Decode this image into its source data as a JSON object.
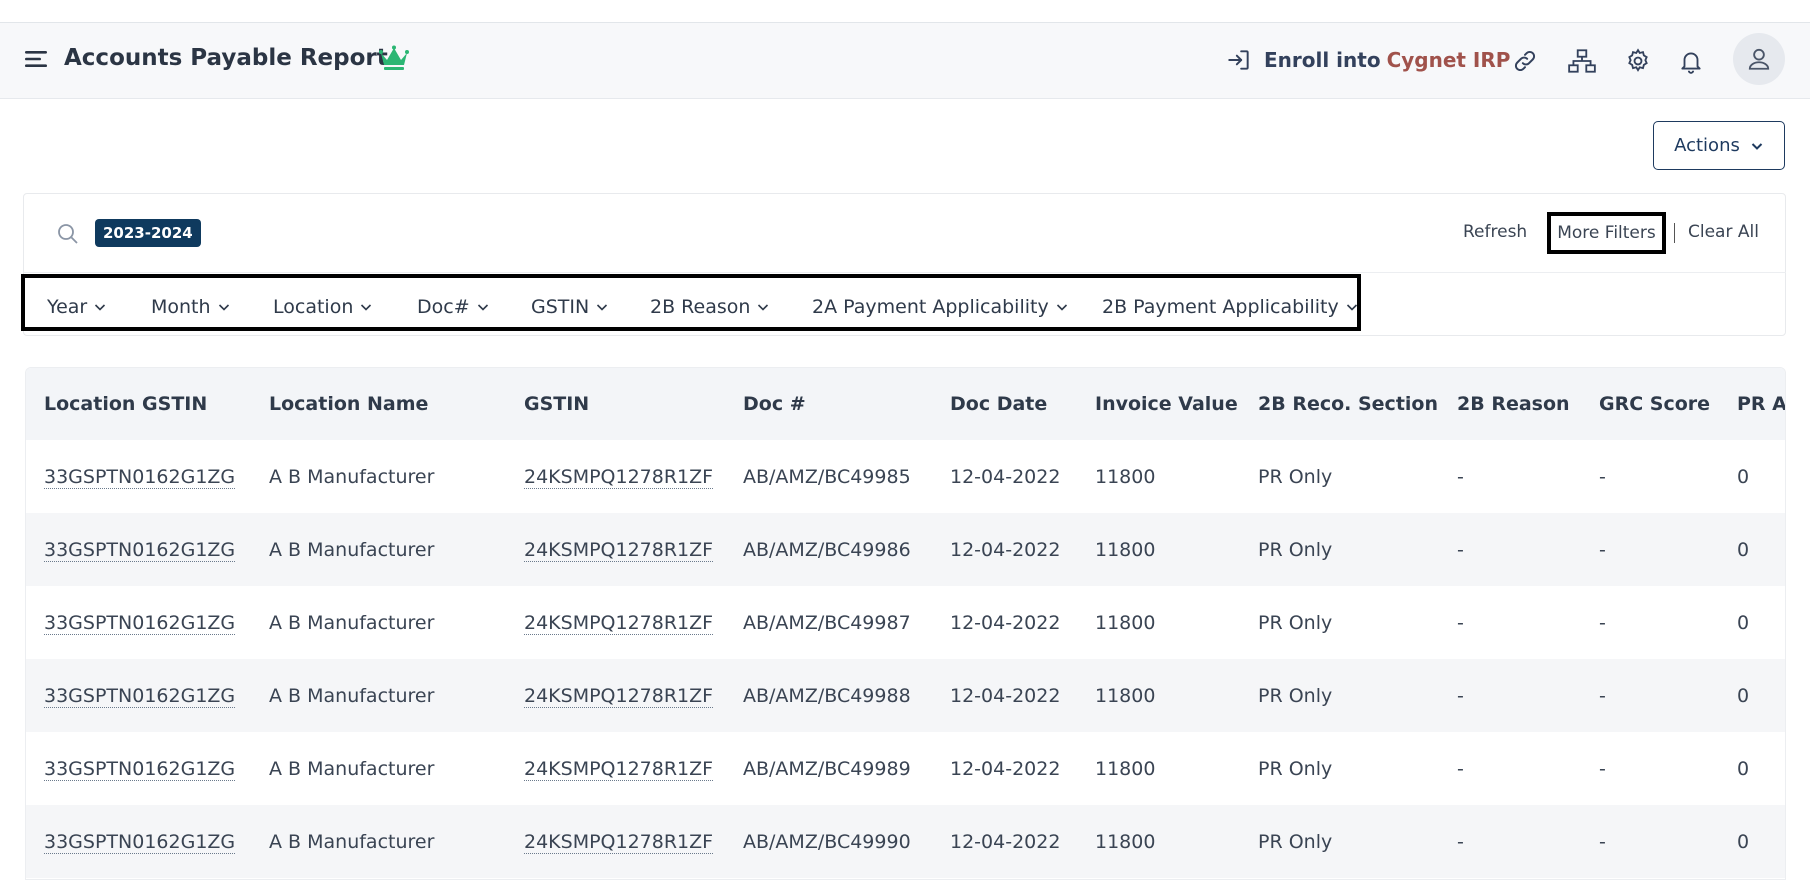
{
  "header": {
    "title": "Accounts Payable Report",
    "enroll_text": "Enroll into",
    "enroll_brand": "Cygnet IRP",
    "icons": [
      "menu-icon",
      "crown-icon",
      "enroll-icon",
      "link-icon",
      "sitemap-icon",
      "gear-icon",
      "bell-icon",
      "user-icon"
    ],
    "accent": "#2bb673",
    "brand_color": "#a0524b"
  },
  "toolbar": {
    "actions_label": "Actions"
  },
  "filters": {
    "chip": "2023-2024",
    "refresh": "Refresh",
    "more_filters": "More Filters",
    "clear_all": "Clear All",
    "dropdowns": [
      "Year",
      "Month",
      "Location",
      "Doc#",
      "GSTIN",
      "2B Reason",
      "2A Payment Applicability",
      "2B Payment Applicability"
    ]
  },
  "table": {
    "columns": [
      "Location GSTIN",
      "Location Name",
      "GSTIN",
      "Doc #",
      "Doc Date",
      "Invoice Value",
      "2B Reco. Section",
      "2B Reason",
      "GRC Score",
      "PR Am"
    ],
    "rows": [
      [
        "33GSPTN0162G1ZG",
        "A B Manufacturer",
        "24KSMPQ1278R1ZF",
        "AB/AMZ/BC49985",
        "12-04-2022",
        "11800",
        "PR Only",
        "-",
        "-",
        "0"
      ],
      [
        "33GSPTN0162G1ZG",
        "A B Manufacturer",
        "24KSMPQ1278R1ZF",
        "AB/AMZ/BC49986",
        "12-04-2022",
        "11800",
        "PR Only",
        "-",
        "-",
        "0"
      ],
      [
        "33GSPTN0162G1ZG",
        "A B Manufacturer",
        "24KSMPQ1278R1ZF",
        "AB/AMZ/BC49987",
        "12-04-2022",
        "11800",
        "PR Only",
        "-",
        "-",
        "0"
      ],
      [
        "33GSPTN0162G1ZG",
        "A B Manufacturer",
        "24KSMPQ1278R1ZF",
        "AB/AMZ/BC49988",
        "12-04-2022",
        "11800",
        "PR Only",
        "-",
        "-",
        "0"
      ],
      [
        "33GSPTN0162G1ZG",
        "A B Manufacturer",
        "24KSMPQ1278R1ZF",
        "AB/AMZ/BC49989",
        "12-04-2022",
        "11800",
        "PR Only",
        "-",
        "-",
        "0"
      ],
      [
        "33GSPTN0162G1ZG",
        "A B Manufacturer",
        "24KSMPQ1278R1ZF",
        "AB/AMZ/BC49990",
        "12-04-2022",
        "11800",
        "PR Only",
        "-",
        "-",
        "0"
      ]
    ]
  }
}
